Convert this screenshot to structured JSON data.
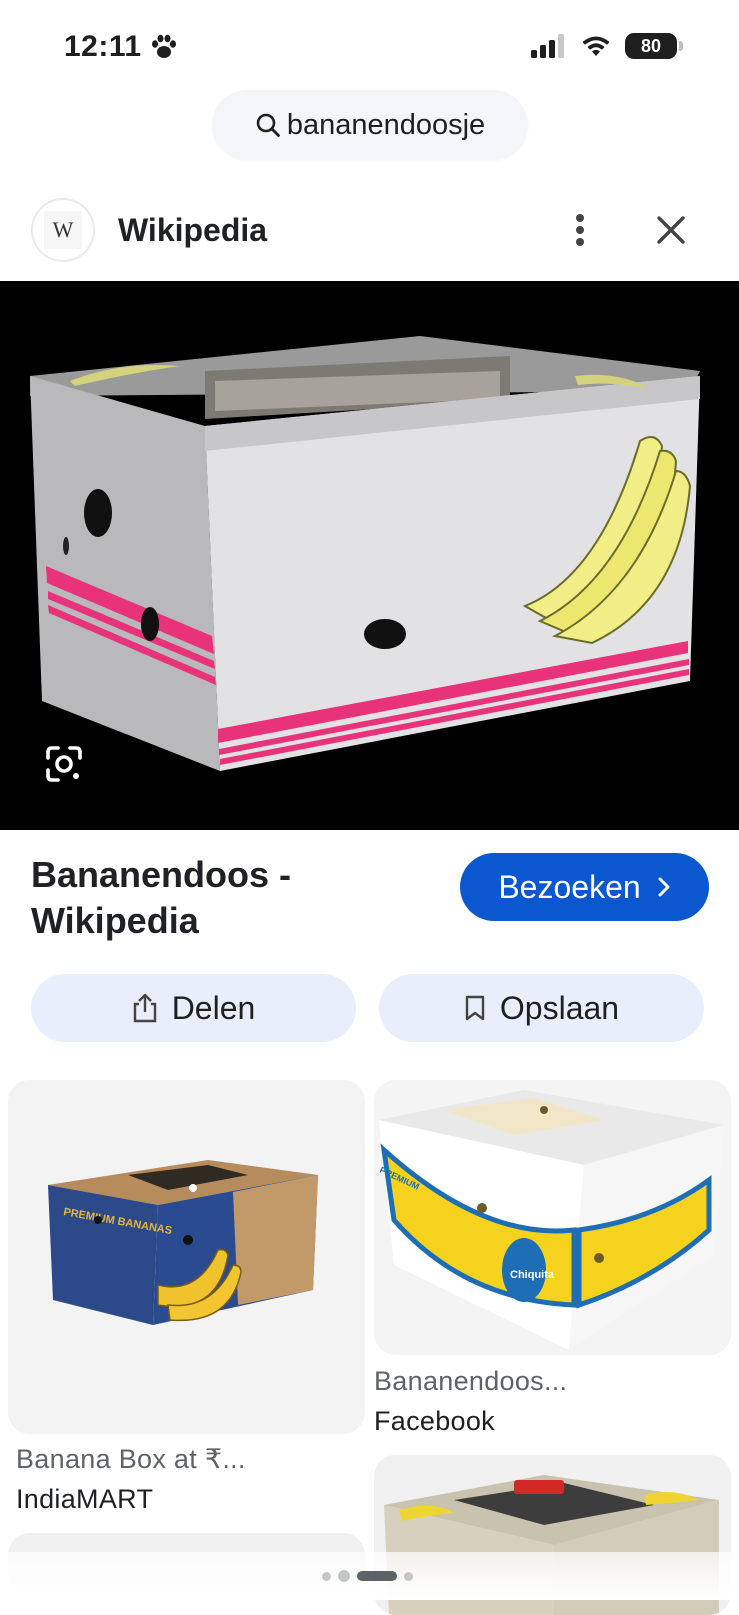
{
  "status_bar": {
    "time": "12:11",
    "battery": "80"
  },
  "search": {
    "query": "bananendoosje"
  },
  "source": {
    "logo_letter": "W",
    "name": "Wikipedia"
  },
  "result": {
    "title_line1": "Bananendoos -",
    "title_line2": "Wikipedia",
    "visit_label": "Bezoeken",
    "share_label": "Delen",
    "save_label": "Opslaan"
  },
  "related": [
    {
      "title": "Banana Box at ₹...",
      "source": "IndiaMART"
    },
    {
      "title": "Bananendoos...",
      "source": "Facebook"
    }
  ],
  "related_labels": {
    "premium": "PREMIUM BANANAS",
    "chiquita": "Chiquita",
    "premium_side": "PREMIUM"
  },
  "colors": {
    "accent": "#0b57d0",
    "chip_bg": "#e8eefb"
  }
}
